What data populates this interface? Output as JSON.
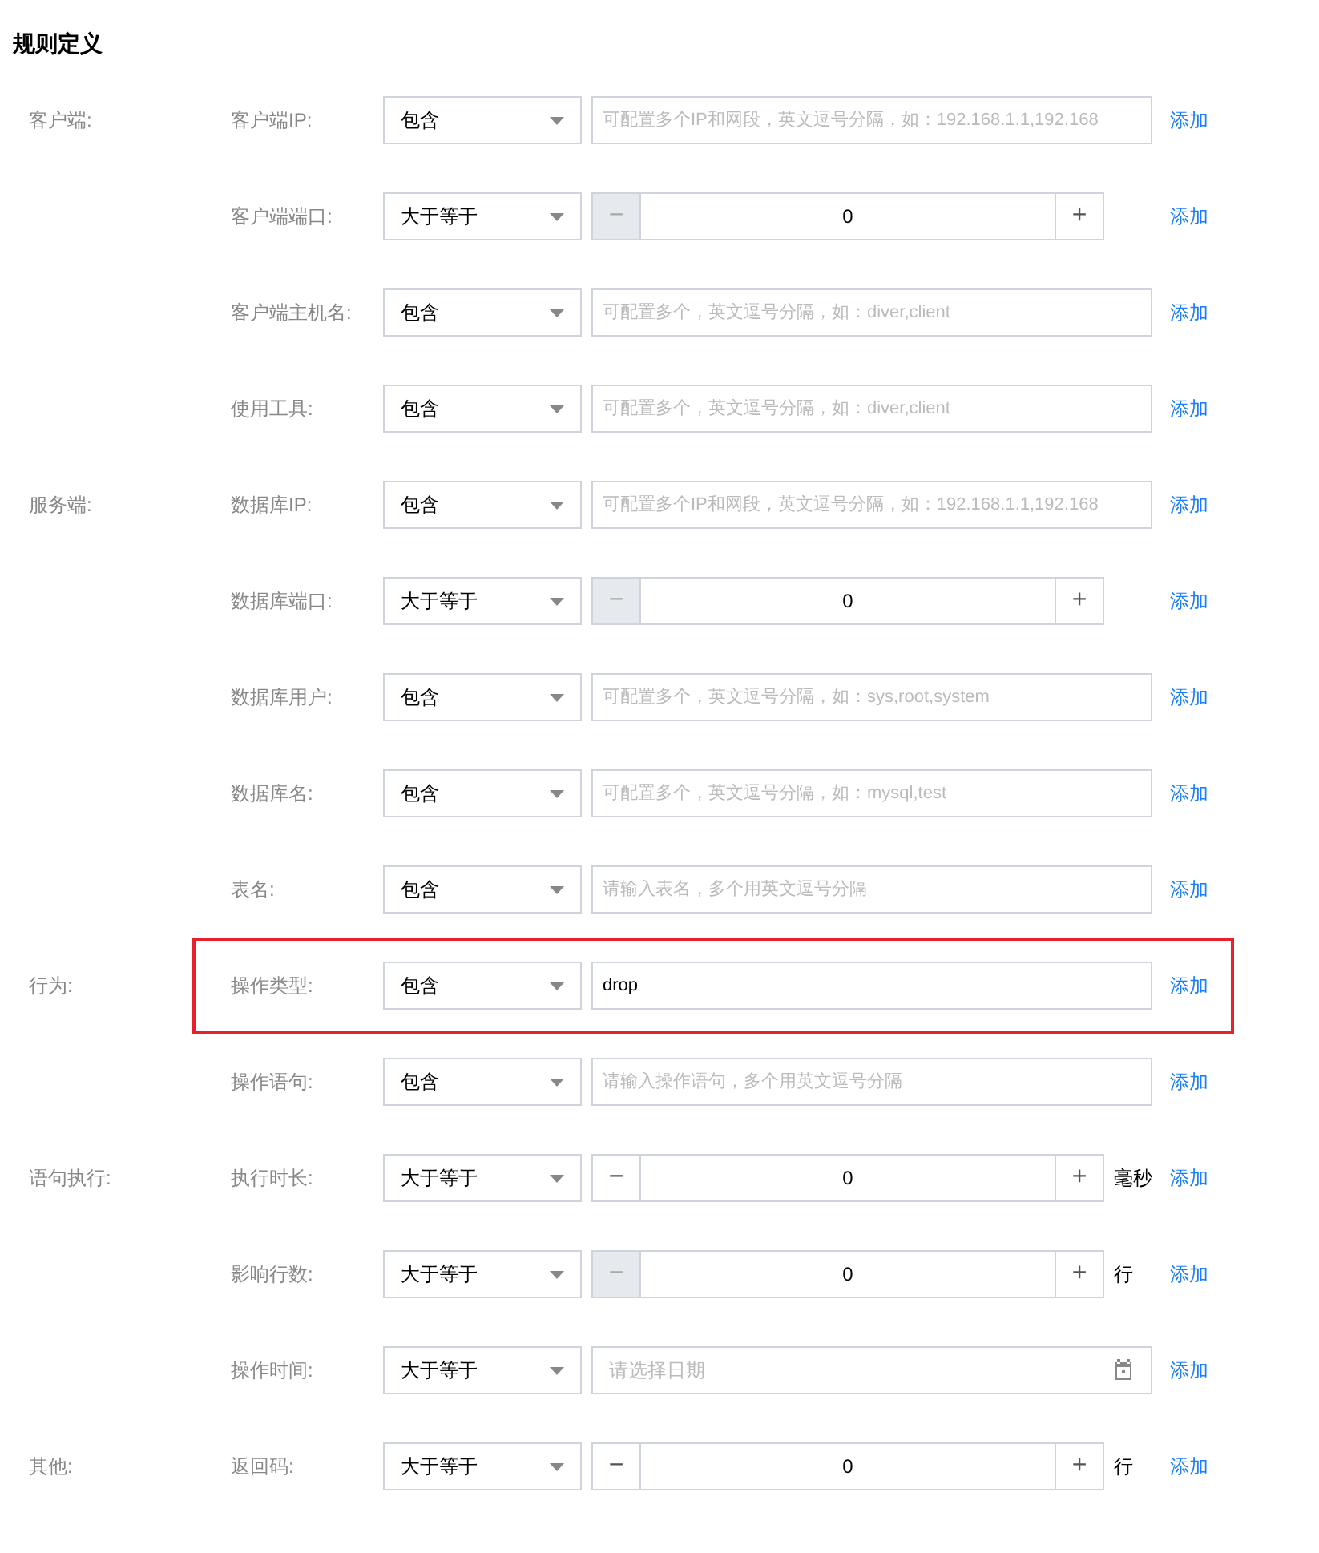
{
  "title": "规则定义",
  "groups": [
    {
      "label": "客户端:",
      "rows": [
        {
          "label": "客户端IP:",
          "operator": "包含",
          "kind": "text",
          "placeholder": "可配置多个IP和网段，英文逗号分隔，如：192.168.1.1,192.168",
          "add": "添加",
          "highlighted": false
        },
        {
          "label": "客户端端口:",
          "operator": "大于等于",
          "kind": "number",
          "value": "0",
          "minus": "−",
          "plus": "+",
          "minus_disabled": true,
          "add": "添加",
          "highlighted": false
        },
        {
          "label": "客户端主机名:",
          "operator": "包含",
          "kind": "text",
          "placeholder": "可配置多个，英文逗号分隔，如：diver,client",
          "add": "添加",
          "highlighted": false
        },
        {
          "label": "使用工具:",
          "operator": "包含",
          "kind": "text",
          "placeholder": "可配置多个，英文逗号分隔，如：diver,client",
          "add": "添加",
          "highlighted": false
        }
      ]
    },
    {
      "label": "服务端:",
      "rows": [
        {
          "label": "数据库IP:",
          "operator": "包含",
          "kind": "text",
          "placeholder": "可配置多个IP和网段，英文逗号分隔，如：192.168.1.1,192.168",
          "add": "添加",
          "highlighted": false
        },
        {
          "label": "数据库端口:",
          "operator": "大于等于",
          "kind": "number",
          "value": "0",
          "minus": "−",
          "plus": "+",
          "minus_disabled": true,
          "add": "添加",
          "highlighted": false
        },
        {
          "label": "数据库用户:",
          "operator": "包含",
          "kind": "text",
          "placeholder": "可配置多个，英文逗号分隔，如：sys,root,system",
          "add": "添加",
          "highlighted": false
        },
        {
          "label": "数据库名:",
          "operator": "包含",
          "kind": "text",
          "placeholder": "可配置多个，英文逗号分隔，如：mysql,test",
          "add": "添加",
          "highlighted": false
        },
        {
          "label": "表名:",
          "operator": "包含",
          "kind": "text",
          "placeholder": "请输入表名，多个用英文逗号分隔",
          "add": "添加",
          "highlighted": false
        }
      ]
    },
    {
      "label": "行为:",
      "rows": [
        {
          "label": "操作类型:",
          "operator": "包含",
          "kind": "text",
          "value": "drop",
          "add": "添加",
          "highlighted": true
        },
        {
          "label": "操作语句:",
          "operator": "包含",
          "kind": "text",
          "placeholder": "请输入操作语句，多个用英文逗号分隔",
          "add": "添加",
          "highlighted": false
        }
      ]
    },
    {
      "label": "语句执行:",
      "rows": [
        {
          "label": "执行时长:",
          "operator": "大于等于",
          "kind": "number",
          "value": "0",
          "minus": "−",
          "plus": "+",
          "minus_disabled": false,
          "unit": "毫秒",
          "add": "添加",
          "highlighted": false
        },
        {
          "label": "影响行数:",
          "operator": "大于等于",
          "kind": "number",
          "value": "0",
          "minus": "−",
          "plus": "+",
          "minus_disabled": true,
          "unit": "行",
          "add": "添加",
          "highlighted": false
        },
        {
          "label": "操作时间:",
          "operator": "大于等于",
          "kind": "date",
          "placeholder": "请选择日期",
          "add": "添加",
          "highlighted": false
        }
      ]
    },
    {
      "label": "其他:",
      "rows": [
        {
          "label": "返回码:",
          "operator": "大于等于",
          "kind": "number",
          "value": "0",
          "minus": "−",
          "plus": "+",
          "minus_disabled": false,
          "unit": "行",
          "add": "添加",
          "highlighted": false
        }
      ]
    }
  ]
}
